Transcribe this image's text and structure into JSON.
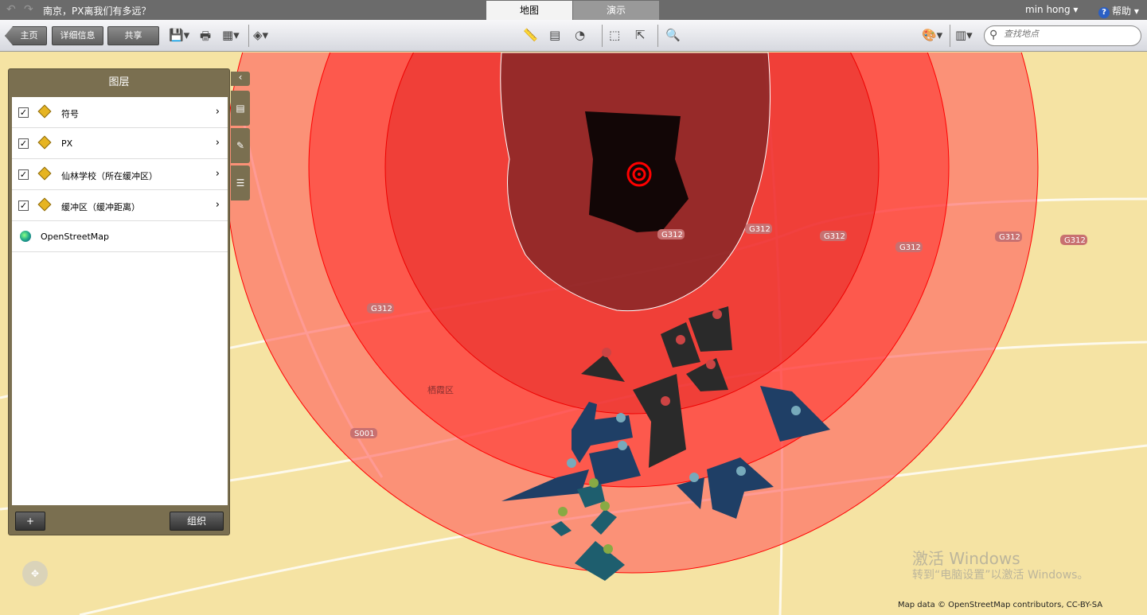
{
  "titlebar": {
    "title": "南京，PX离我们有多远？",
    "tabs": [
      "地图",
      "演示"
    ],
    "user": "min hong ▾",
    "help": "帮助 ▾",
    "help_icon": "?"
  },
  "toolbar": {
    "home": "主页",
    "details": "详细信息",
    "share": "共享",
    "search_placeholder": "查找地点"
  },
  "panel": {
    "title": "图层",
    "layers": [
      {
        "label": "符号"
      },
      {
        "label": "PX"
      },
      {
        "label": "仙林学校（所在缓冲区）"
      },
      {
        "label": "缓冲区（缓冲距离）"
      }
    ],
    "basemap": "OpenStreetMap",
    "add": "+",
    "organize": "组织"
  },
  "map": {
    "road_labels": [
      "G312",
      "G312",
      "G312",
      "G312",
      "G312",
      "G312",
      "G312",
      "S001"
    ],
    "district": "栖霞区",
    "attribution": "Map data © OpenStreetMap contributors, CC-BY-SA"
  },
  "watermark": {
    "line1": "激活 Windows",
    "line2": "转到“电脑设置”以激活 Windows。"
  },
  "colors": {
    "buffer": "#ff2020",
    "px": "#120606",
    "school_blue": "#1f3f66",
    "school_teal": "#1e5e6e"
  }
}
